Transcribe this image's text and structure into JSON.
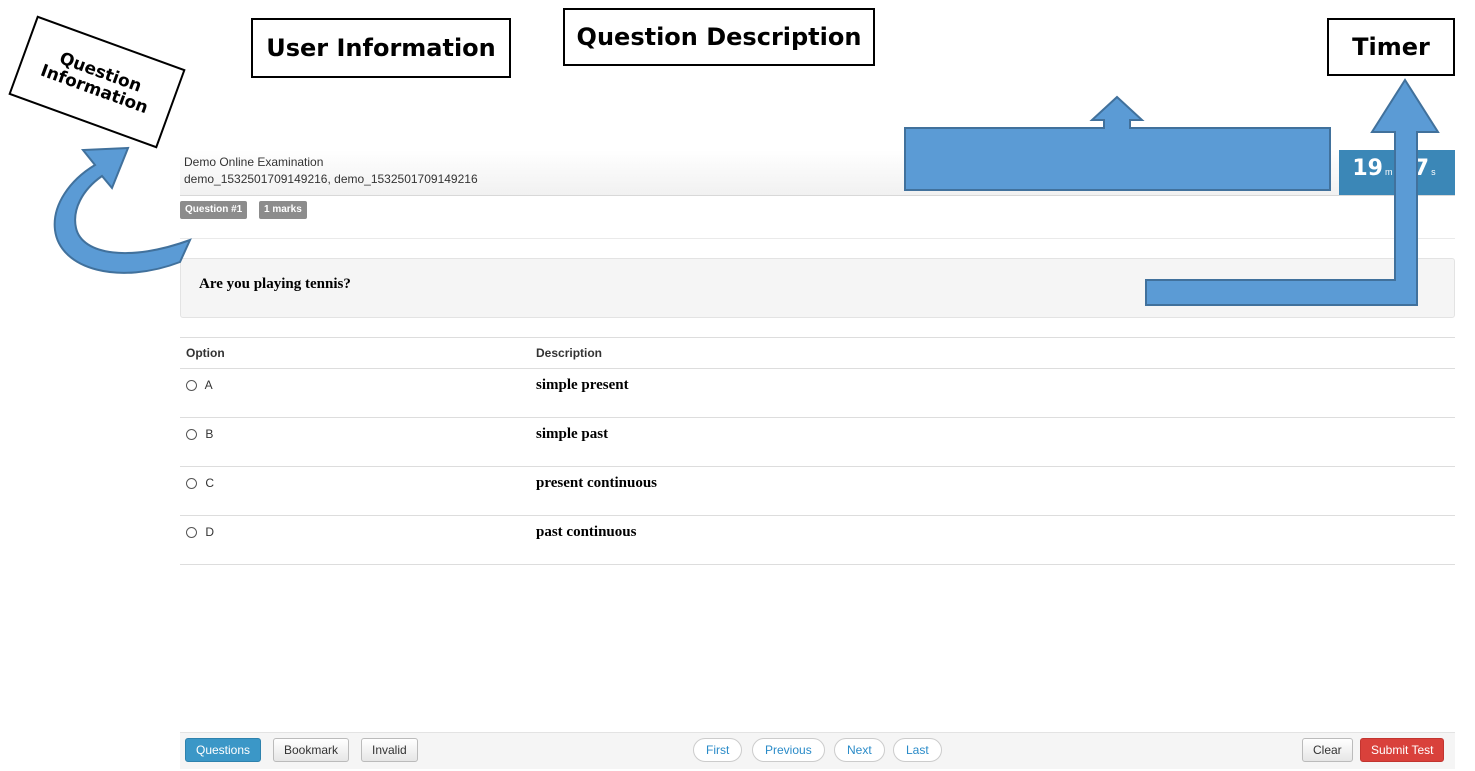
{
  "annotations": {
    "user_information": "User Information",
    "question_description": "Question Description",
    "timer": "Timer",
    "question_information_line1": "Question",
    "question_information_line2": "Information"
  },
  "header": {
    "exam_title": "Demo Online Examination",
    "user_names": "demo_1532501709149216, demo_1532501709149216"
  },
  "timer": {
    "minutes": "19",
    "minutes_unit": "m",
    "seconds": "47",
    "seconds_unit": "s"
  },
  "question_info": {
    "number_badge": "Question #1",
    "marks_badge": "1 marks"
  },
  "question": {
    "text": "Are you playing tennis?"
  },
  "options_table": {
    "headers": {
      "option": "Option",
      "description": "Description"
    },
    "rows": [
      {
        "letter": "A",
        "description": "simple present"
      },
      {
        "letter": "B",
        "description": "simple past"
      },
      {
        "letter": "C",
        "description": "present continuous"
      },
      {
        "letter": "D",
        "description": "past continuous"
      }
    ]
  },
  "footer": {
    "questions": "Questions",
    "bookmark": "Bookmark",
    "invalid": "Invalid",
    "first": "First",
    "previous": "Previous",
    "next": "Next",
    "last": "Last",
    "clear": "Clear",
    "submit": "Submit Test"
  },
  "colors": {
    "accent_blue": "#3b87b7",
    "arrow_blue": "#5b9bd5",
    "submit_red": "#d9413b"
  }
}
